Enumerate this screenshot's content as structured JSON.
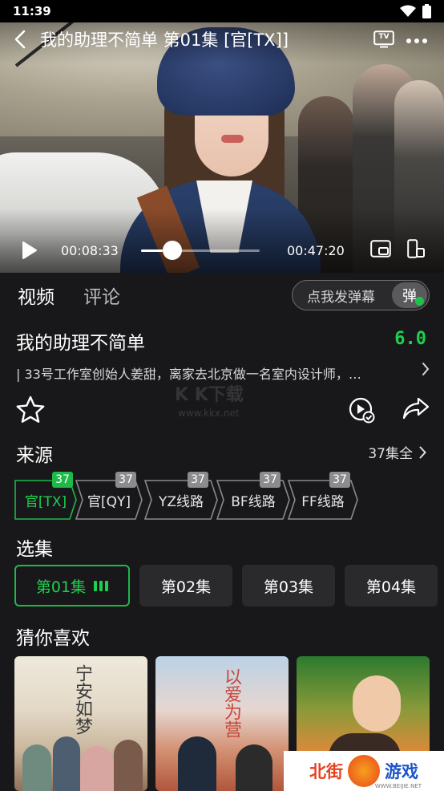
{
  "status_bar": {
    "time": "11:39"
  },
  "player": {
    "title": "我的助理不简单 第01集 [官[TX]]",
    "tv_label": "TV",
    "current_time": "00:08:33",
    "duration": "00:47:20",
    "progress": 0.181
  },
  "tabs": {
    "video": "视频",
    "comments": "评论"
  },
  "danmu": {
    "label": "点我发弹幕",
    "toggle": "弹"
  },
  "show": {
    "title": "我的助理不简单",
    "score": "6.0",
    "description": "| 33号工作室创始人姜甜，离家去北京做一名室内设计师，…"
  },
  "watermark": {
    "main": "K K下载",
    "sub": "www.kkx.net"
  },
  "sources": {
    "section_title": "来源",
    "total": "37集全",
    "items": [
      {
        "label": "官[TX]",
        "count": "37",
        "active": true
      },
      {
        "label": "官[QY]",
        "count": "37",
        "active": false
      },
      {
        "label": "YZ线路",
        "count": "37",
        "active": false
      },
      {
        "label": "BF线路",
        "count": "37",
        "active": false
      },
      {
        "label": "FF线路",
        "count": "37",
        "active": false
      }
    ]
  },
  "episodes": {
    "section_title": "选集",
    "items": [
      "第01集",
      "第02集",
      "第03集",
      "第04集"
    ]
  },
  "recommend": {
    "section_title": "猜你喜欢",
    "posters": [
      {
        "title": "宁安如梦"
      },
      {
        "title": "以爱为营"
      },
      {
        "title": ""
      }
    ]
  },
  "brand_logo": {
    "text_a": "北街",
    "text_b": "游戏",
    "url_text": "WWW.BEIJIE.NET"
  },
  "colors": {
    "accent": "#1fcf4f",
    "background": "#18181a",
    "chip": "#2a2a2c"
  }
}
